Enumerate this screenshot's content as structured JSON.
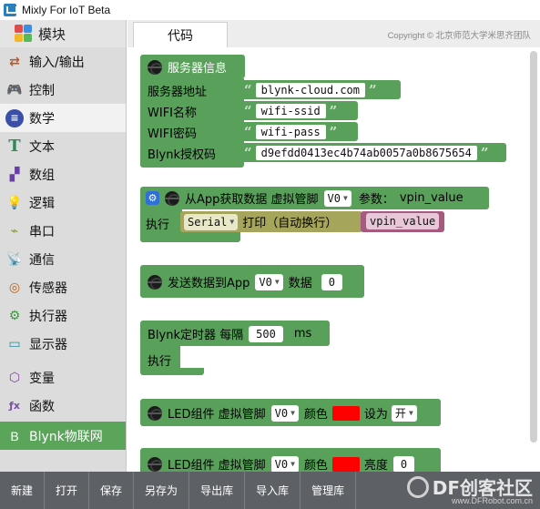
{
  "window": {
    "title": "Mixly For IoT Beta"
  },
  "sidebar": {
    "header": "模块",
    "categories": [
      {
        "label": "输入/输出"
      },
      {
        "label": "控制"
      },
      {
        "label": "数学"
      },
      {
        "label": "文本"
      },
      {
        "label": "数组"
      },
      {
        "label": "逻辑"
      },
      {
        "label": "串口"
      },
      {
        "label": "通信"
      },
      {
        "label": "传感器"
      },
      {
        "label": "执行器"
      },
      {
        "label": "显示器"
      },
      {
        "label": "变量"
      },
      {
        "label": "函数"
      },
      {
        "label": "Blynk物联网"
      }
    ]
  },
  "tabs": {
    "code": "代码"
  },
  "copyright": "Copyright © 北京师范大学米思齐团队",
  "blocks": {
    "server": {
      "title": "服务器信息",
      "server_label": "服务器地址",
      "server_value": "blynk-cloud.com",
      "wifi_label": "WIFI名称",
      "wifi_value": "wifi-ssid",
      "pass_label": "WIFI密码",
      "pass_value": "wifi-pass",
      "auth_label": "Blynk授权码",
      "auth_value": "d9efdd0413ec4b74ab0057a0b8675654"
    },
    "receive": {
      "title": "从App获取数据 虚拟管脚",
      "pin": "V0",
      "param_label": "参数：",
      "param": "vpin_value",
      "exec": "执行",
      "serial": "Serial",
      "print": "打印（自动换行）",
      "var": "vpin_value"
    },
    "send": {
      "title": "发送数据到App",
      "pin": "V0",
      "data_label": "数据",
      "value": "0"
    },
    "timer": {
      "title": "Blynk定时器 每隔",
      "value": "500",
      "unit": "ms",
      "exec": "执行"
    },
    "led1": {
      "title": "LED组件 虚拟管脚",
      "pin": "V0",
      "color_label": "颜色",
      "set_label": "设为",
      "state": "开"
    },
    "led2": {
      "title": "LED组件 虚拟管脚",
      "pin": "V0",
      "color_label": "颜色",
      "bright_label": "亮度",
      "value": "0"
    }
  },
  "toolbar": {
    "buttons": [
      "新建",
      "打开",
      "保存",
      "另存为",
      "导出库",
      "导入库",
      "管理库"
    ]
  },
  "watermark": {
    "text": "DF创客社区",
    "url": "www.DFRobot.com.cn"
  },
  "colors": {
    "block_green": "#59a05b",
    "led_red": "#ff0000",
    "serial_olive": "#a5a55b",
    "var_magenta": "#a55b80"
  }
}
